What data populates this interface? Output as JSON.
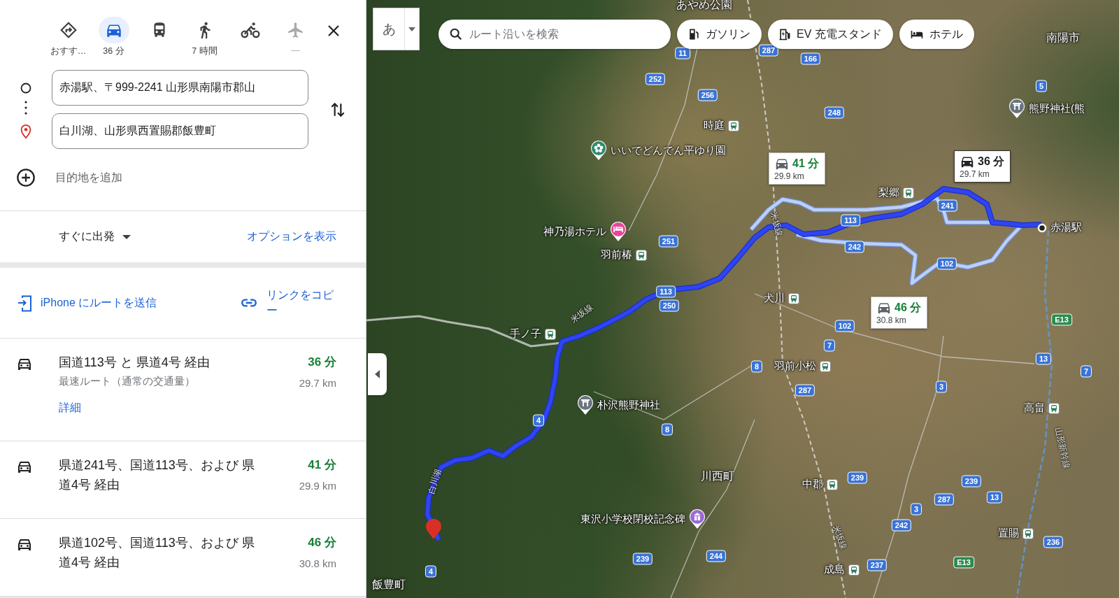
{
  "travel_modes": [
    {
      "kind": "recommended",
      "label": "おすす…",
      "selected": false,
      "disabled": false
    },
    {
      "kind": "car",
      "label": "36 分",
      "selected": true,
      "disabled": false
    },
    {
      "kind": "transit",
      "selected": false,
      "disabled": false
    },
    {
      "kind": "walk",
      "label": "7 時間",
      "selected": false,
      "disabled": false
    },
    {
      "kind": "bike",
      "selected": false,
      "disabled": false
    },
    {
      "kind": "flight",
      "label": "—",
      "selected": false,
      "disabled": true
    }
  ],
  "directions": {
    "origin": "赤湯駅、〒999-2241 山形県南陽市郡山",
    "destination": "白川湖、山形県西置賜郡飯豊町",
    "add_destination": "目的地を追加"
  },
  "departure": {
    "label": "すぐに出発",
    "options_link": "オプションを表示"
  },
  "share": {
    "send_to_phone": "iPhone にルートを送信",
    "copy_link": "リンクをコピー"
  },
  "routes": [
    {
      "title": "国道113号 と 県道4号 経由",
      "subtitle": "最速ルート（通常の交通量）",
      "details_link": "詳細",
      "time": "36 分",
      "distance": "29.7 km"
    },
    {
      "title": "県道241号、国道113号、および 県道4号 経由",
      "time": "41 分",
      "distance": "29.9 km"
    },
    {
      "title": "県道102号、国道113号、および 県道4号 経由",
      "time": "46 分",
      "distance": "30.8 km"
    }
  ],
  "map": {
    "input_method": "あ",
    "search": {
      "placeholder": "ルート沿いを検索"
    },
    "chips": [
      {
        "kind": "gas",
        "label": "ガソリン"
      },
      {
        "kind": "ev",
        "label": "EV 充電スタンド"
      },
      {
        "kind": "hotel",
        "label": "ホテル"
      }
    ],
    "places": [
      {
        "kind": "area",
        "name": "あやめ公園"
      },
      {
        "kind": "area",
        "name": "南陽市"
      },
      {
        "kind": "shrine",
        "name": "熊野神社(熊"
      },
      {
        "kind": "station",
        "name": "時庭"
      },
      {
        "kind": "park",
        "name": "いいでどんでん平ゆり園"
      },
      {
        "kind": "station",
        "name": "梨郷"
      },
      {
        "kind": "hotel",
        "name": "神乃湯ホテル"
      },
      {
        "kind": "origin",
        "name": "赤湯駅"
      },
      {
        "kind": "station",
        "name": "羽前椿"
      },
      {
        "kind": "station",
        "name": "犬川"
      },
      {
        "kind": "station",
        "name": "手ノ子"
      },
      {
        "kind": "station",
        "name": "羽前小松"
      },
      {
        "kind": "shrine",
        "name": "朴沢熊野神社"
      },
      {
        "kind": "station",
        "name": "高畠"
      },
      {
        "kind": "area",
        "name": "川西町"
      },
      {
        "kind": "station",
        "name": "中郡"
      },
      {
        "kind": "monument",
        "name": "東沢小学校閉校記念碑"
      },
      {
        "kind": "station",
        "name": "置賜"
      },
      {
        "kind": "station",
        "name": "成島"
      },
      {
        "kind": "area",
        "name": "飯豊町"
      }
    ],
    "line_labels": [
      "米坂線",
      "米坂線",
      "白川湖",
      "米坂線",
      "山形新幹線"
    ],
    "road_shields": [
      {
        "kind": "route",
        "number": "11"
      },
      {
        "kind": "route",
        "number": "287"
      },
      {
        "kind": "route",
        "number": "166"
      },
      {
        "kind": "route",
        "number": "252"
      },
      {
        "kind": "route",
        "number": "256"
      },
      {
        "kind": "route",
        "number": "5"
      },
      {
        "kind": "route",
        "number": "248"
      },
      {
        "kind": "route",
        "number": "241"
      },
      {
        "kind": "route",
        "number": "113"
      },
      {
        "kind": "route",
        "number": "251"
      },
      {
        "kind": "route",
        "number": "242"
      },
      {
        "kind": "route",
        "number": "102"
      },
      {
        "kind": "expressway",
        "number": "E13"
      },
      {
        "kind": "route",
        "number": "113"
      },
      {
        "kind": "route",
        "number": "250"
      },
      {
        "kind": "route",
        "number": "102"
      },
      {
        "kind": "route",
        "number": "7"
      },
      {
        "kind": "route",
        "number": "13"
      },
      {
        "kind": "route",
        "number": "8"
      },
      {
        "kind": "route",
        "number": "7"
      },
      {
        "kind": "route",
        "number": "3"
      },
      {
        "kind": "route",
        "number": "287"
      },
      {
        "kind": "route",
        "number": "4"
      },
      {
        "kind": "route",
        "number": "8"
      },
      {
        "kind": "route",
        "number": "239"
      },
      {
        "kind": "route",
        "number": "239"
      },
      {
        "kind": "route",
        "number": "287"
      },
      {
        "kind": "route",
        "number": "13"
      },
      {
        "kind": "route",
        "number": "3"
      },
      {
        "kind": "route",
        "number": "242"
      },
      {
        "kind": "route",
        "number": "236"
      },
      {
        "kind": "route",
        "number": "239"
      },
      {
        "kind": "route",
        "number": "244"
      },
      {
        "kind": "route",
        "number": "237"
      },
      {
        "kind": "expressway",
        "number": "E13"
      },
      {
        "kind": "route",
        "number": "4"
      }
    ],
    "route_callouts": [
      {
        "time": "41 分",
        "distance": "29.9 km",
        "selected": false
      },
      {
        "time": "36 分",
        "distance": "29.7 km",
        "selected": true
      },
      {
        "time": "46 分",
        "distance": "30.8 km",
        "selected": false
      }
    ]
  }
}
